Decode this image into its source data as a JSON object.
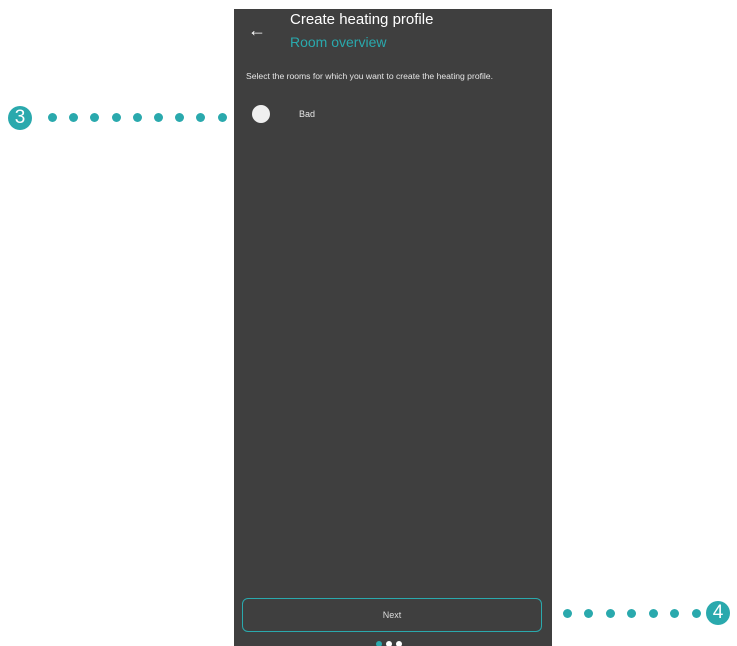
{
  "colors": {
    "accent": "#2aa9ad",
    "screen_bg": "#3f3f3f",
    "text_primary": "#ffffff"
  },
  "header": {
    "back_icon": "←",
    "title": "Create heating profile",
    "subtitle": "Room overview"
  },
  "content": {
    "instruction": "Select the rooms for which you want to create the heating profile.",
    "rooms": [
      {
        "label": "Bad",
        "selected": false
      }
    ]
  },
  "footer": {
    "next_label": "Next",
    "pager": {
      "total": 3,
      "current": 1
    }
  },
  "callouts": [
    {
      "number": "3",
      "target": "room-radio"
    },
    {
      "number": "4",
      "target": "next-button"
    }
  ]
}
